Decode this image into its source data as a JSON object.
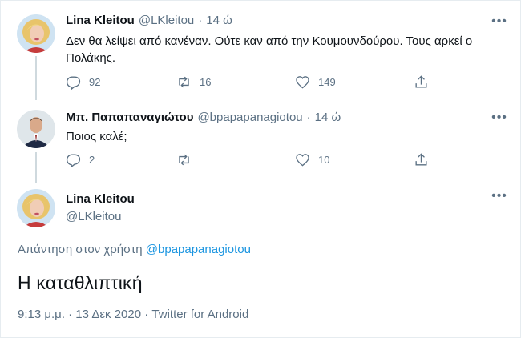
{
  "tweets": [
    {
      "name": "Lina Kleitou",
      "handle": "@LKleitou",
      "dot": "·",
      "time": "14 ώ",
      "text": "Δεν θα λείψει από κανέναν.  Ούτε καν από την Κουμουνδούρου. Τους αρκεί ο Πολάκης.",
      "actions": {
        "replies": "92",
        "retweets": "16",
        "likes": "149"
      }
    },
    {
      "name": "Μπ. Παπαπαναγιώτου",
      "handle": "@bpapapanagiotou",
      "dot": "·",
      "time": "14 ώ",
      "text": "Ποιος καλέ;",
      "actions": {
        "replies": "2",
        "retweets": "",
        "likes": "10"
      }
    }
  ],
  "main_tweet": {
    "name": "Lina Kleitou",
    "handle": "@LKleitou",
    "reply_prefix": "Απάντηση στον χρήστη",
    "reply_handle": "@bpapapanagiotou",
    "text": "Η καταθλιπτική",
    "timestamp": "9:13 μ.μ. · 13 Δεκ 2020 · Twitter for Android"
  },
  "colors": {
    "link": "#1b95e0",
    "muted": "#5b7083",
    "thread_line": "#cfd9de"
  },
  "icons": {
    "more": "more-horizontal-icon",
    "reply": "reply-icon",
    "retweet": "retweet-icon",
    "like": "heart-icon",
    "share": "share-icon"
  }
}
